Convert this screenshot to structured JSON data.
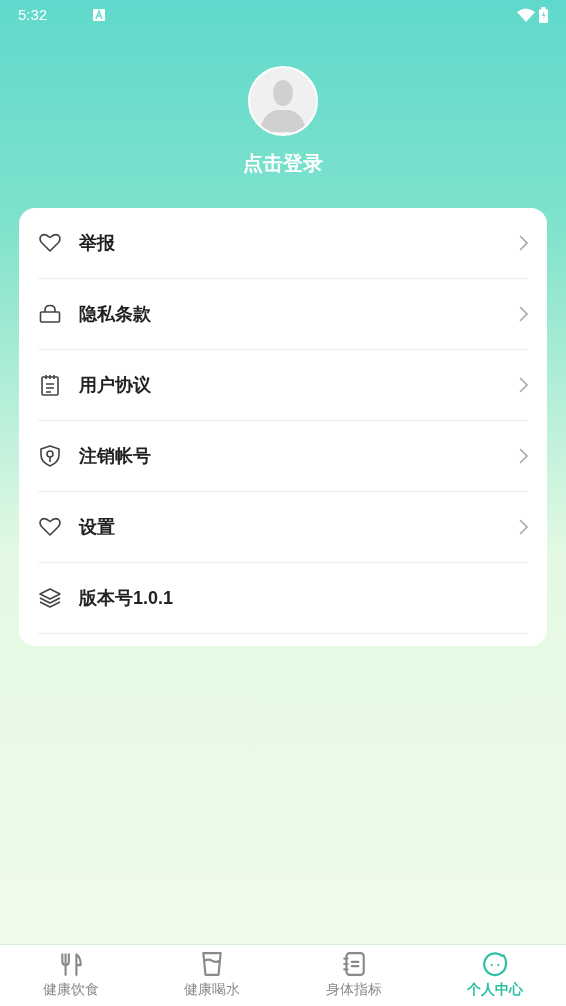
{
  "status_bar": {
    "time": "5:32"
  },
  "profile": {
    "login_label": "点击登录"
  },
  "menu": [
    {
      "kind": "heart",
      "label": "举报",
      "chevron": true
    },
    {
      "kind": "lock",
      "label": "隐私条款",
      "chevron": true
    },
    {
      "kind": "notepad",
      "label": "用户协议",
      "chevron": true
    },
    {
      "kind": "shield",
      "label": "注销帐号",
      "chevron": true
    },
    {
      "kind": "heart",
      "label": "设置",
      "chevron": true
    },
    {
      "kind": "layers",
      "label": "版本号1.0.1",
      "chevron": false
    }
  ],
  "tabs": [
    {
      "kind": "food",
      "label": "健康饮食",
      "selected": false
    },
    {
      "kind": "water",
      "label": "健康喝水",
      "selected": false
    },
    {
      "kind": "notebook",
      "label": "身体指标",
      "selected": false
    },
    {
      "kind": "face",
      "label": "个人中心",
      "selected": true
    }
  ]
}
